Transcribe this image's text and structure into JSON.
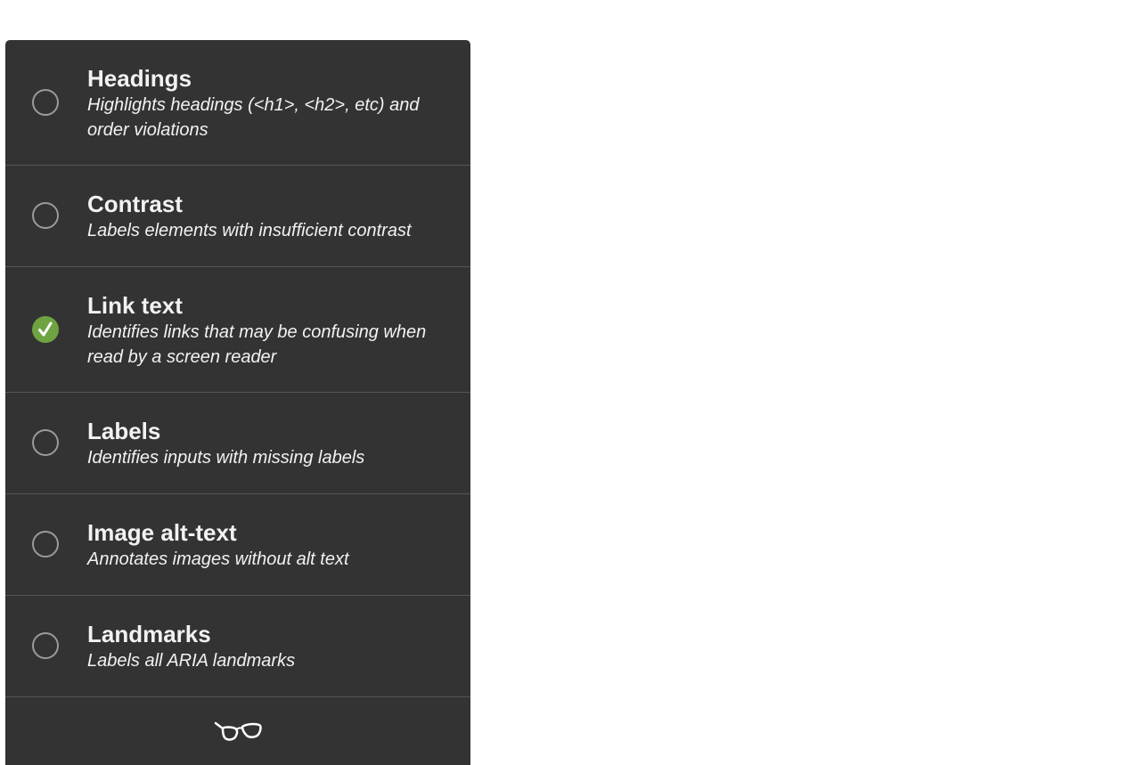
{
  "panel": {
    "items": [
      {
        "title": "Headings",
        "description": "Highlights headings (<h1>, <h2>, etc) and order violations",
        "checked": false
      },
      {
        "title": "Contrast",
        "description": "Labels elements with insufficient contrast",
        "checked": false
      },
      {
        "title": "Link text",
        "description": "Identifies links that may be confusing when read by a screen reader",
        "checked": true
      },
      {
        "title": "Labels",
        "description": "Identifies inputs with missing labels",
        "checked": false
      },
      {
        "title": "Image alt-text",
        "description": "Annotates images without alt text",
        "checked": false
      },
      {
        "title": "Landmarks",
        "description": "Labels all ARIA landmarks",
        "checked": false
      }
    ],
    "footer_icon": "glasses-icon"
  },
  "colors": {
    "panel_background": "#333333",
    "divider": "#555555",
    "text": "#f2f2f2",
    "radio_border": "#9a9a9a",
    "checked_accent": "#6fa341"
  }
}
